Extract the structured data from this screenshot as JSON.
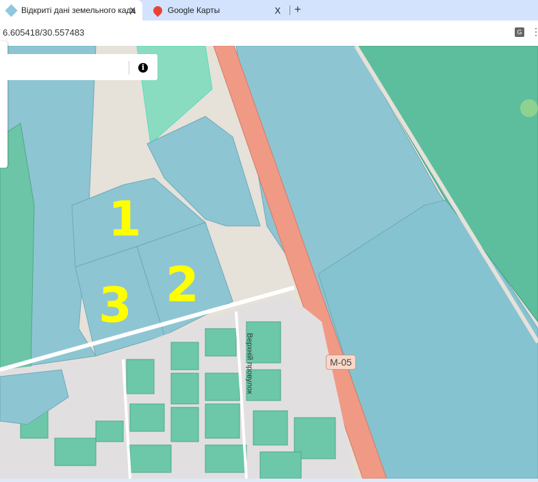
{
  "tabs": [
    {
      "title": "Відкриті дані земельного када",
      "close": "X"
    },
    {
      "title": "Google Карты",
      "close": "X"
    }
  ],
  "new_tab": "+",
  "address": "6.605418/30.557483",
  "map": {
    "search_value": "",
    "info_icon": "i",
    "parcel_labels": [
      "1",
      "2",
      "3"
    ],
    "road_label": "M-05",
    "street_label": "Верхній провулок"
  },
  "colors": {
    "parcel": "#8ec5d3",
    "green": "#5dbe9e",
    "road": "#f09a85"
  }
}
